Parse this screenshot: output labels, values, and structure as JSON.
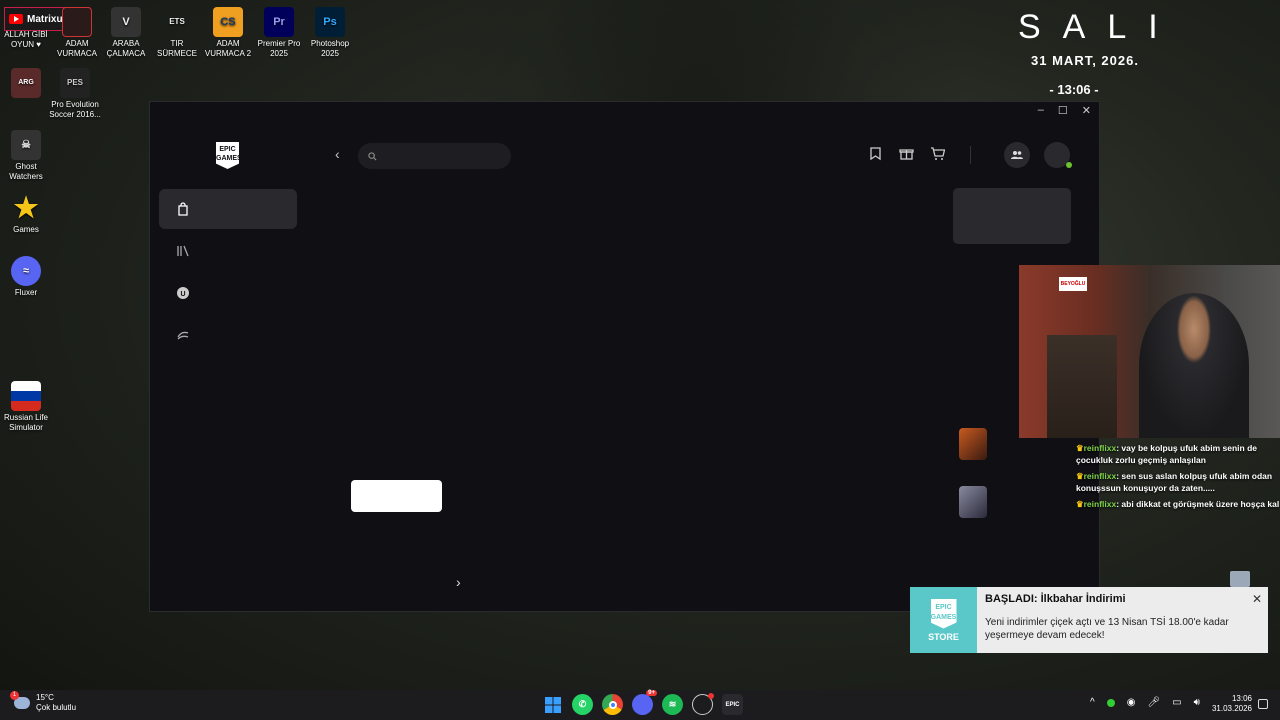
{
  "desktop": {
    "youtube_badge": "Matrixufuk",
    "icons": [
      {
        "label": "ALLAH GİBİ OYUN ♥"
      },
      {
        "label": "ADAM VURMACA"
      },
      {
        "label": "ARABA ÇALMACA"
      },
      {
        "label": "TIR SÜRMECE"
      },
      {
        "label": "ADAM VURMACA 2"
      },
      {
        "label": "Premier Pro 2025",
        "glyph": "Pr"
      },
      {
        "label": "Photoshop 2025",
        "glyph": "Ps"
      },
      {
        "label": "Pro Evolution Soccer 2016..."
      },
      {
        "label": "Ghost Watchers"
      },
      {
        "label": "Games"
      },
      {
        "label": "Fluxer"
      },
      {
        "label": "Russian Life Simulator"
      }
    ]
  },
  "clock_widget": {
    "day": "SALI",
    "date": "31 MART, 2026.",
    "time": "- 13:06 -"
  },
  "epic": {
    "logo_text": "EPIC GAMES",
    "search_placeholder": ""
  },
  "chat": [
    {
      "user": "reinflixx",
      "text": ": vay be kolpuş ufuk abim senin de çocukluk zorlu geçmiş anlaşılan"
    },
    {
      "user": "reinflixx",
      "text": ": sen sus aslan kolpuş ufuk abim odan konuşssun konuşuyor da zaten....."
    },
    {
      "user": "reinflixx",
      "text": ": abi dikkat et görüşmek üzere hoşça kal"
    }
  ],
  "webcam": {
    "sign_text": "BEYOĞLU"
  },
  "toast": {
    "logo_text": "EPIC GAMES",
    "logo_sub": "STORE",
    "title": "BAŞLADI: İlkbahar İndirimi",
    "body": "Yeni indirimler çiçek açtı ve 13 Nisan TSİ 18.00'e kadar yeşermeye devam edecek!"
  },
  "taskbar": {
    "weather_temp": "15°C",
    "weather_desc": "Çok bulutlu",
    "weather_badge": "1",
    "discord_badge": "9+",
    "time": "13:06",
    "date": "31.03.2026"
  }
}
